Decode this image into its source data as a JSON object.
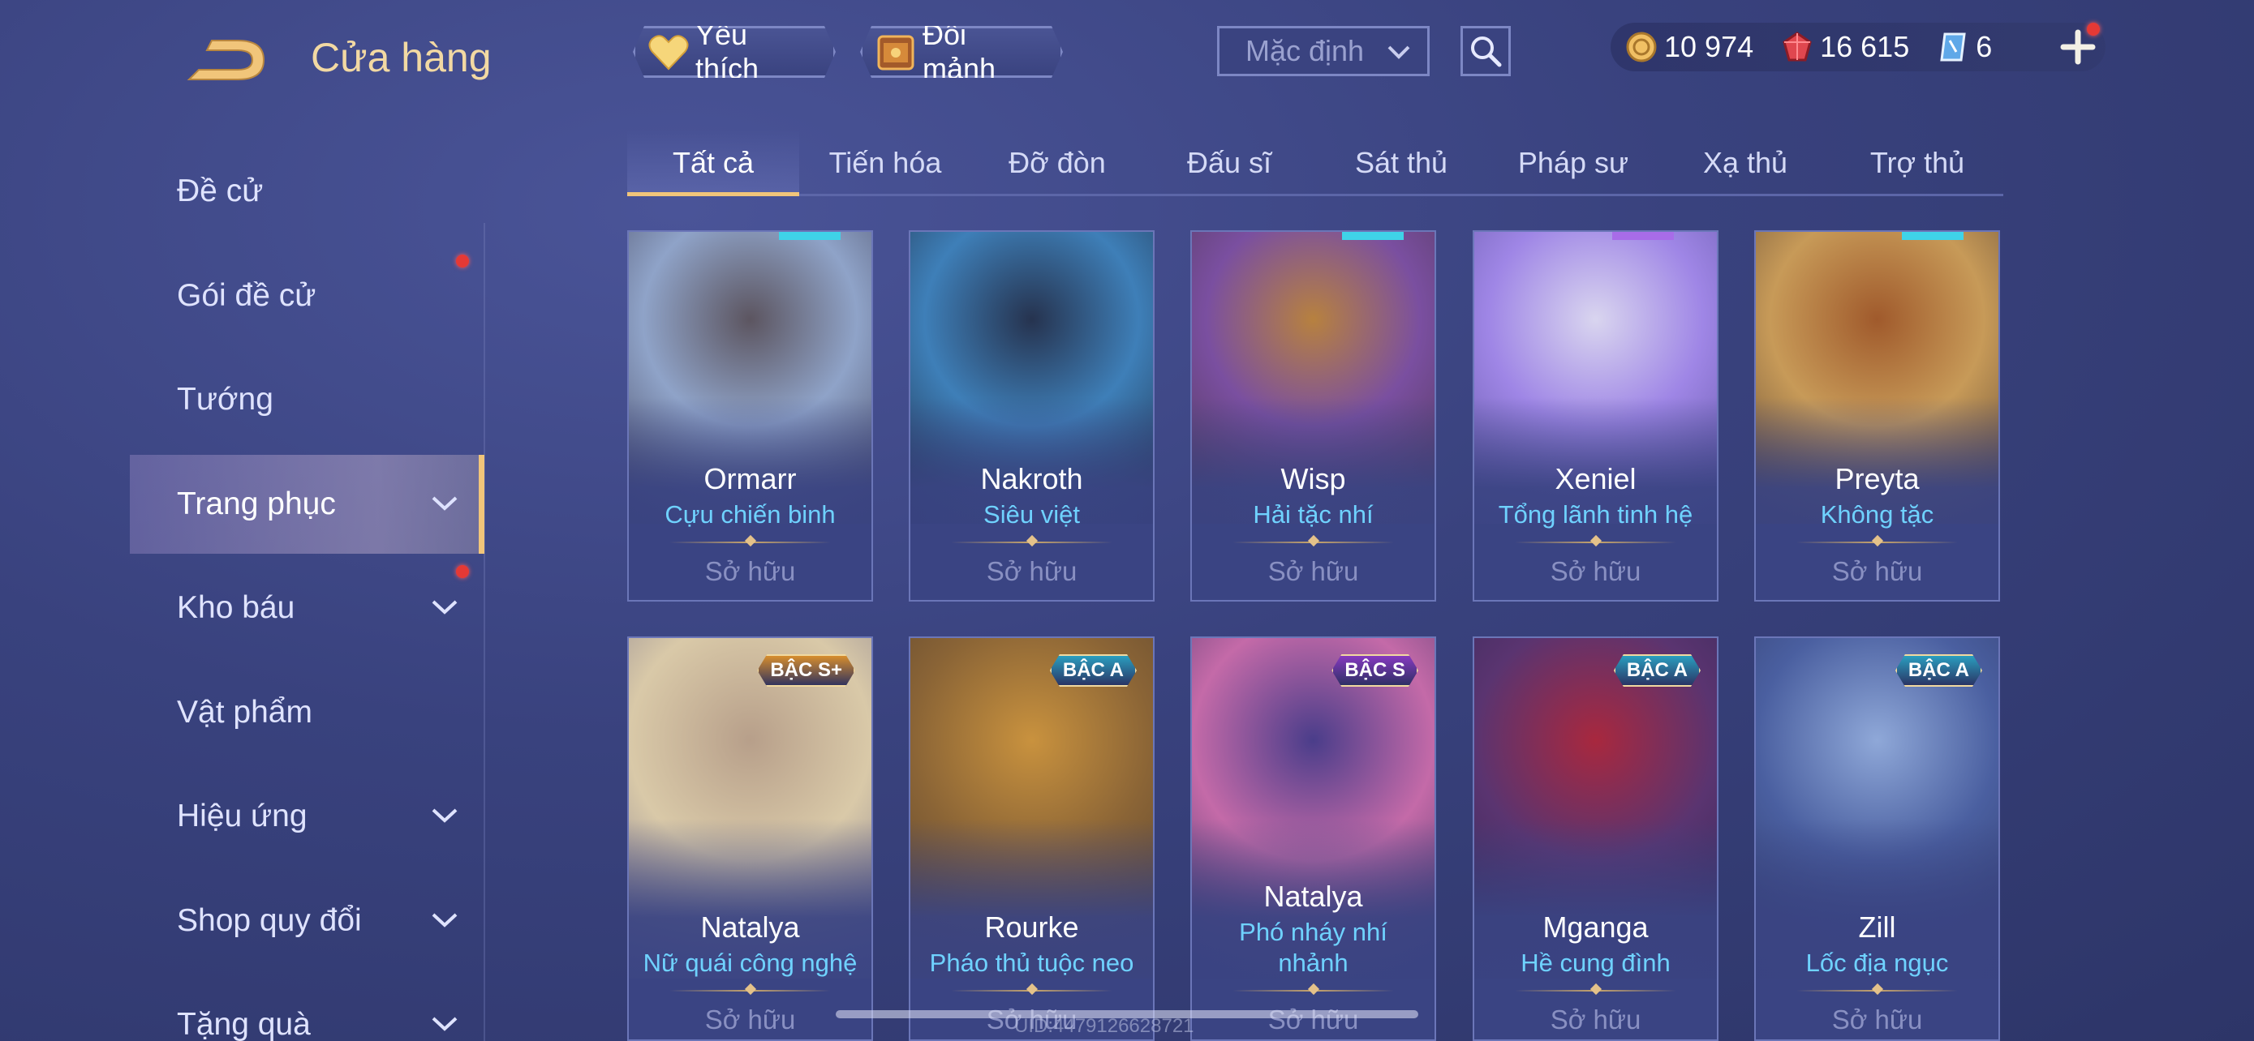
{
  "header": {
    "title": "Cửa hàng",
    "favorite_label": "Yêu thích",
    "fragment_label": "Đổi mảnh",
    "sort_value": "Mặc định"
  },
  "currency": {
    "gold": "10 974",
    "vouchers": "16 615",
    "tickets": "6"
  },
  "sidebar": {
    "items": [
      {
        "label": "Đề cử",
        "chevron": false,
        "dot": false
      },
      {
        "label": "Gói đề cử",
        "chevron": false,
        "dot": true
      },
      {
        "label": "Tướng",
        "chevron": false,
        "dot": false
      },
      {
        "label": "Trang phục",
        "chevron": true,
        "dot": false,
        "active": true
      },
      {
        "label": "Kho báu",
        "chevron": true,
        "dot": true
      },
      {
        "label": "Vật phẩm",
        "chevron": false,
        "dot": false
      },
      {
        "label": "Hiệu ứng",
        "chevron": true,
        "dot": false
      },
      {
        "label": "Shop quy đổi",
        "chevron": true,
        "dot": false
      },
      {
        "label": "Tặng quà",
        "chevron": true,
        "dot": false
      }
    ]
  },
  "tabs": [
    "Tất cả",
    "Tiến hóa",
    "Đỡ đòn",
    "Đấu sĩ",
    "Sát thủ",
    "Pháp sư",
    "Xạ thủ",
    "Trợ thủ"
  ],
  "active_tab": "Tất cả",
  "owned_label": "Sở hữu",
  "cards": [
    {
      "hero": "Ormarr",
      "skin": "Cựu chiến binh",
      "colors": [
        "#8fa3c8",
        "#5c5560",
        "#3b3950"
      ]
    },
    {
      "hero": "Nakroth",
      "skin": "Siêu việt",
      "colors": [
        "#3e7fb8",
        "#26334f",
        "#1b2438"
      ]
    },
    {
      "hero": "Wisp",
      "skin": "Hải tặc nhí",
      "colors": [
        "#7a4fa0",
        "#b7813f",
        "#4a3348"
      ]
    },
    {
      "hero": "Xeniel",
      "skin": "Tổng lãnh tinh hệ",
      "colors": [
        "#9f86e6",
        "#d9d5ef",
        "#5a4e9c"
      ]
    },
    {
      "hero": "Preyta",
      "skin": "Không tặc",
      "colors": [
        "#c79a58",
        "#a05a2c",
        "#4e3a2e"
      ]
    },
    {
      "hero": "Natalya",
      "skin": "Nữ quái công nghệ",
      "badge": "BẬC S+",
      "badge_color": "#e0922a",
      "colors": [
        "#d9c9a8",
        "#b79f8a",
        "#6a6688"
      ]
    },
    {
      "hero": "Rourke",
      "skin": "Pháo thủ tuộc neo",
      "badge": "BẬC A",
      "badge_color": "#2aa4c4",
      "colors": [
        "#8a6436",
        "#c9923e",
        "#4c3a2c"
      ]
    },
    {
      "hero": "Natalya",
      "skin": "Phó nháy nhí nhảnh",
      "badge": "BẬC S",
      "badge_color": "#8a3ac4",
      "colors": [
        "#c46aa8",
        "#4a3d8a",
        "#2c2a5c"
      ]
    },
    {
      "hero": "Mganga",
      "skin": "Hề cung đình",
      "badge": "BẬC A",
      "badge_color": "#2aa4c4",
      "colors": [
        "#5a3470",
        "#a8283e",
        "#2a2550"
      ]
    },
    {
      "hero": "Zill",
      "skin": "Lốc địa ngục",
      "badge": "BẬC A",
      "badge_color": "#2aa4c4",
      "colors": [
        "#4a5fa0",
        "#8fa8d8",
        "#2c3460"
      ]
    }
  ],
  "uid_text": "UID:4479126628721",
  "icons": {
    "back": "back-arrow-icon",
    "favorite": "heart-icon",
    "fragment": "chest-icon",
    "search": "search-icon",
    "gold": "coin-icon",
    "vouchers": "gem-icon",
    "tickets": "ticket-icon",
    "add": "plus-icon"
  }
}
